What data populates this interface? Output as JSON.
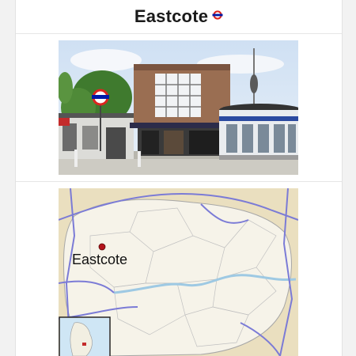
{
  "header": {
    "title": "Eastcote",
    "roundel_icon": "london-underground-roundel-icon"
  },
  "photo": {
    "subject": "station-building-photo"
  },
  "map": {
    "place_label": "Eastcote",
    "marker_icon": "location-dot-icon"
  },
  "colors": {
    "roundel_red": "#dc241f",
    "roundel_blue": "#0019a8",
    "map_border_line": "#7b7bd6"
  }
}
